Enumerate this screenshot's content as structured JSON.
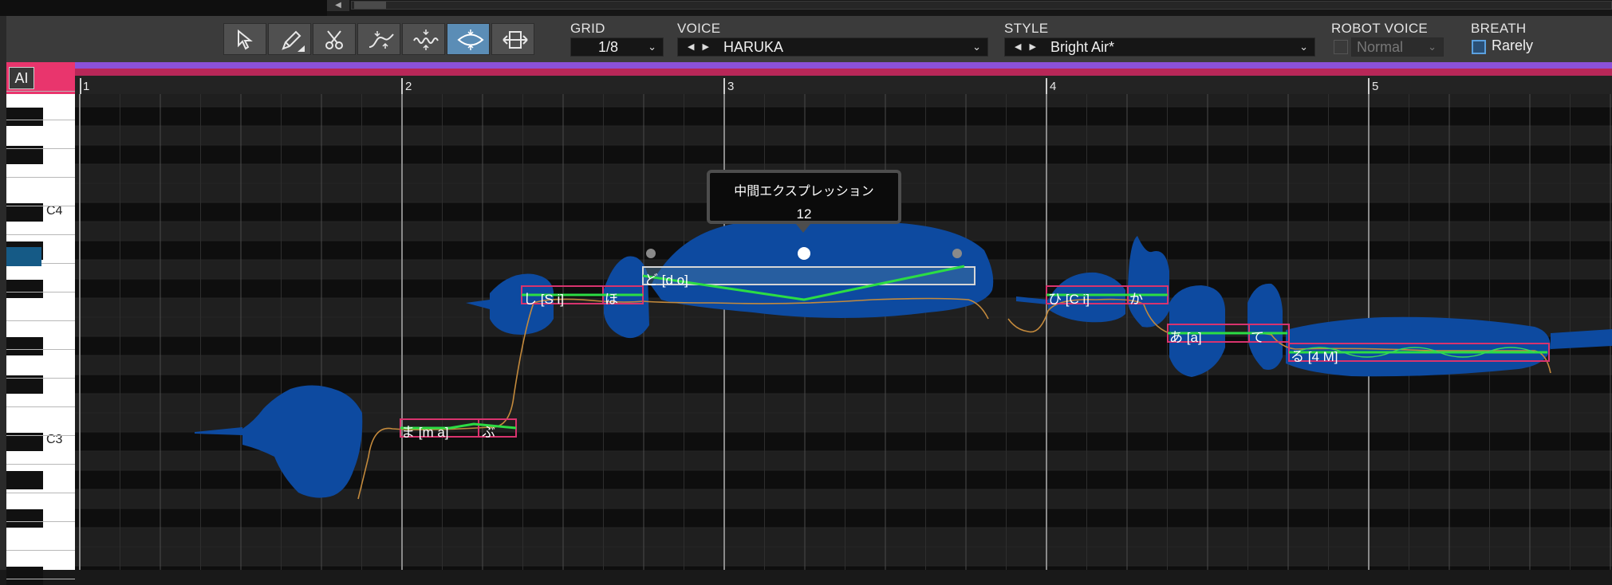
{
  "toolbar": {
    "tools": [
      {
        "name": "pointer-tool",
        "active": false
      },
      {
        "name": "pencil-tool",
        "active": false
      },
      {
        "name": "scissors-tool",
        "active": false
      },
      {
        "name": "pitch-curve-tool",
        "active": false
      },
      {
        "name": "vibrato-tool",
        "active": false
      },
      {
        "name": "intermediate-expression-tool",
        "active": true
      },
      {
        "name": "timing-tool",
        "active": false
      }
    ],
    "grid": {
      "label": "GRID",
      "value": "1/8"
    },
    "voice": {
      "label": "VOICE",
      "value": "HARUKA"
    },
    "style": {
      "label": "STYLE",
      "value": "Bright Air*"
    },
    "robot_voice": {
      "label": "ROBOT VOICE",
      "value": "Normal",
      "enabled": false
    },
    "breath": {
      "label": "BREATH",
      "value": "Rarely",
      "checked": false
    }
  },
  "ai_badge": "AI",
  "ruler": {
    "measures": [
      "1",
      "2",
      "3",
      "4",
      "5"
    ]
  },
  "piano": {
    "c_labels": [
      "C4",
      "C3"
    ]
  },
  "notes": [
    {
      "lyric": "ま [m a]"
    },
    {
      "lyric": "ぶ"
    },
    {
      "lyric": "し [S i]"
    },
    {
      "lyric": "ほ"
    },
    {
      "lyric": "ど [d o]"
    },
    {
      "lyric": "ひ [C i]"
    },
    {
      "lyric": "か"
    },
    {
      "lyric": "あ [a]"
    },
    {
      "lyric": "て"
    },
    {
      "lyric": "る [4 M]"
    }
  ],
  "tooltip": {
    "title": "中間エクスプレッション",
    "value": "12"
  },
  "colors": {
    "accent_active_tool": "#5b8db6",
    "ai_badge": "#e9356d",
    "purple_bar": "#8b51d9",
    "pink_bar": "#b82758",
    "waveform": "#0d4aa0",
    "note_border": "#d8336e",
    "selected_note_border": "#d6d6d6",
    "expression_line": "#2cdd44",
    "pitch_curve": "#c48a3c"
  }
}
